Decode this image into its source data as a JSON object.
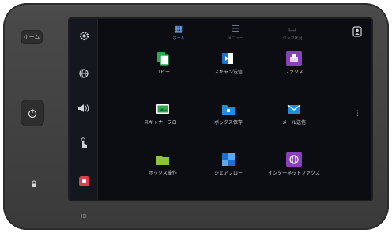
{
  "bezel": {
    "home_button_label": "ホーム",
    "power_icon": "power-icon",
    "small_button_icon": "lock-icon",
    "led_label": "ID"
  },
  "sidebar": {
    "items": [
      {
        "icon": "settings-gear-icon"
      },
      {
        "icon": "globe-icon"
      },
      {
        "icon": "volume-icon"
      },
      {
        "icon": "touch-icon"
      },
      {
        "icon": "stop-icon",
        "color": "#e83a4e"
      }
    ]
  },
  "tabs": [
    {
      "label": "ホーム",
      "active": true
    },
    {
      "label": "メニュー",
      "active": false
    },
    {
      "label": "ジョブ状況",
      "active": false
    }
  ],
  "top_right": {
    "icon": "user-icon"
  },
  "apps": [
    {
      "label": "コピー",
      "icon": "copy-icon",
      "color": "#2fa84f"
    },
    {
      "label": "スキャン送信",
      "icon": "scan-icon",
      "color": "#1f6fd1"
    },
    {
      "label": "ファクス",
      "icon": "fax-icon",
      "color": "#8b3fbf"
    },
    {
      "label": "スキャナーフロー",
      "icon": "scanner-flow-icon",
      "color": "#2fa84f"
    },
    {
      "label": "ボックス保存",
      "icon": "box-save-icon",
      "color": "#1f8ee0"
    },
    {
      "label": "メール送信",
      "icon": "mail-icon",
      "color": "#1f8ee0"
    },
    {
      "label": "ボックス操作",
      "icon": "box-folder-icon",
      "color": "#8ec43a"
    },
    {
      "label": "シェアフロー",
      "icon": "share-flow-icon",
      "color": "#1f6fd1"
    },
    {
      "label": "インターネットファクス",
      "icon": "internet-fax-icon",
      "color": "#8b3fbf"
    }
  ],
  "more_indicator": "⋮"
}
